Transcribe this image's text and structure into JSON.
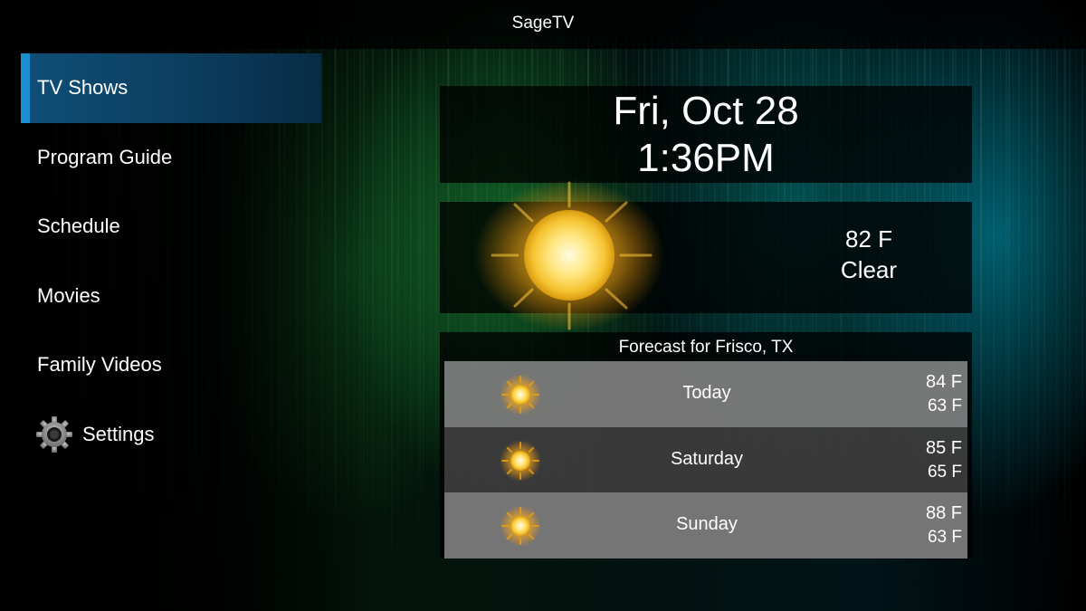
{
  "app": {
    "title": "SageTV"
  },
  "menu": {
    "items": [
      {
        "label": "TV Shows",
        "active": true
      },
      {
        "label": "Program Guide"
      },
      {
        "label": "Schedule"
      },
      {
        "label": "Movies"
      },
      {
        "label": "Family Videos"
      },
      {
        "label": "Settings",
        "icon": "gear-icon"
      }
    ]
  },
  "datetime": {
    "date": "Fri, Oct 28",
    "time": "1:36PM"
  },
  "current_weather": {
    "temperature": "82 F",
    "condition": "Clear",
    "icon": "sun-icon"
  },
  "forecast": {
    "title": "Forecast for Frisco, TX",
    "days": [
      {
        "day": "Today",
        "high": "84 F",
        "low": "63 F",
        "icon": "sun-icon"
      },
      {
        "day": "Saturday",
        "high": "85 F",
        "low": "65 F",
        "icon": "sun-icon"
      },
      {
        "day": "Sunday",
        "high": "88 F",
        "low": "63 F",
        "icon": "sun-icon"
      }
    ]
  },
  "colors": {
    "active_item": "#0b3c5d",
    "active_accent": "#1c8fd1",
    "forecast_light_row": "#969696",
    "forecast_dark_row": "#464646"
  }
}
